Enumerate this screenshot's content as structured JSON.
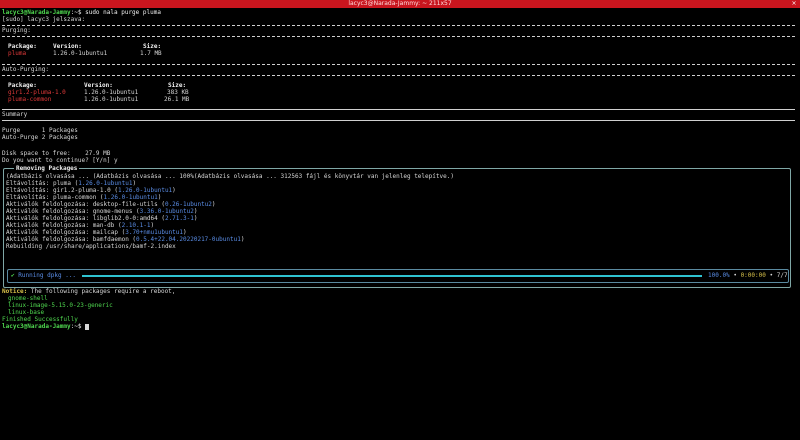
{
  "window": {
    "title": "lacyc3@Narada-Jammy: ~ 211x57",
    "close_glyph": "×"
  },
  "prompt": {
    "user": "lacyc3@Narada-Jammy",
    "sep": ":~$ ",
    "command": "sudo nala purge pluma"
  },
  "sudo_line": "[sudo] lacyc3 jelszava:",
  "purging": {
    "heading": "Purging:",
    "headers": [
      "Package:",
      "Version:",
      "Size:"
    ],
    "rows": [
      {
        "name": "pluma",
        "version": "1.26.0-1ubuntu1",
        "size": "1.7 MB"
      }
    ]
  },
  "auto_purging": {
    "heading": "Auto-Purging:",
    "headers": [
      "Package:",
      "Version:",
      "Size:"
    ],
    "rows": [
      {
        "name": "gir1.2-pluma-1.0",
        "version": "1.26.0-1ubuntu1",
        "size": "383 KB"
      },
      {
        "name": "pluma-common",
        "version": "1.26.0-1ubuntu1",
        "size": "26.1 MB"
      }
    ]
  },
  "summary": {
    "heading": "Summary",
    "lines": [
      "Purge      1 Packages",
      "Auto-Purge 2 Packages"
    ],
    "disk_space": "Disk space to free:    27.9 MB",
    "continue": "Do you want to continue? [Y/n] y"
  },
  "removing": {
    "title": "Removing Packages",
    "db_line": "(Adatbázis olvasása ... (Adatbázis olvasása ... 100%(Adatbázis olvasása ... 312563 fájl és könyvtár van jelenleg telepítve.)",
    "lines": [
      {
        "pre": "Eltávolítás: pluma (",
        "ver": "1.26.0-1ubuntu1",
        "post": ")"
      },
      {
        "pre": "Eltávolítás: gir1.2-pluma-1.0 (",
        "ver": "1.26.0-1ubuntu1",
        "post": ")"
      },
      {
        "pre": "Eltávolítás: pluma-common (",
        "ver": "1.26.0-1ubuntu1",
        "post": ")"
      },
      {
        "pre": "Aktiválók feldolgozása: desktop-file-utils (",
        "ver": "0.26-1ubuntu2",
        "post": ")"
      },
      {
        "pre": "Aktiválók feldolgozása: gnome-menus (",
        "ver": "3.36.0-1ubuntu2",
        "post": ")"
      },
      {
        "pre": "Aktiválók feldolgozása: libglib2.0-0:amd64 (",
        "ver": "2.71.3-1",
        "post": ")"
      },
      {
        "pre": "Aktiválók feldolgozása: man-db (",
        "ver": "2.10.1-1",
        "post": ")"
      },
      {
        "pre": "Aktiválók feldolgozása: mailcap (",
        "ver": "3.70+nmu1ubuntu1",
        "post": ")"
      },
      {
        "pre": "Aktiválók feldolgozása: bamfdaemon (",
        "ver": "0.5.4+22.04.20220217-0ubuntu1",
        "post": ")"
      }
    ],
    "rebuilding": "Rebuilding /usr/share/applications/bamf-2.index",
    "progress": {
      "check": "✔",
      "label": "Running dpkg ...",
      "fraction": 1.0,
      "percent": "100.0%",
      "bullet1": "•",
      "elapsed": "0:00:00",
      "bullet2": "•",
      "count": "7/7"
    }
  },
  "notice": {
    "label": "Notice:",
    "text": " The following packages require a reboot,",
    "packages": [
      "gnome-shell",
      "linux-image-5.15.0-23-generic",
      "linux-base"
    ]
  },
  "finished": "Finished Successfully",
  "final_prompt": {
    "user": "lacyc3@Narada-Jammy",
    "sep": ":~$ "
  },
  "colors": {
    "titlebar": "#c9151e",
    "green": "#4fd84f",
    "blue": "#5a8de6",
    "red": "#e13a3a",
    "yellow": "#d8c14a"
  }
}
